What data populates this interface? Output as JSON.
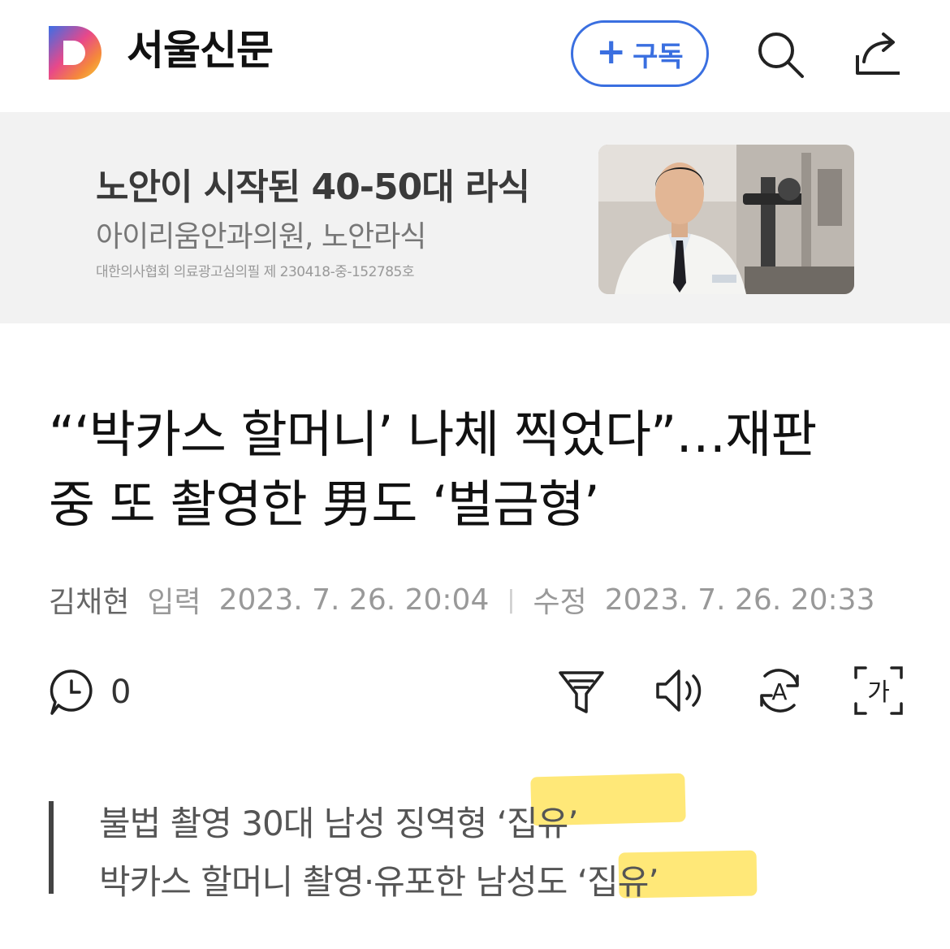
{
  "header": {
    "logo_letter": "D",
    "brand": "서울신문",
    "subscribe_label": "구독",
    "subscribe_plus": "+"
  },
  "ad": {
    "title": "노안이 시작된 40-50대 라식",
    "subtitle": "아이리움안과의원, 노안라식",
    "note": "대한의사협회 의료광고심의필 제 230418-중-152785호"
  },
  "article": {
    "headline_line1": "“‘박카스 할머니’ 나체 찍었다”…재판",
    "headline_line2": "중 또 촬영한 男도 ‘벌금형’",
    "author": "김채현",
    "input_label": "입력",
    "input_date": "2023. 7. 26. 20:04",
    "separator": "|",
    "edit_label": "수정",
    "edit_date": "2023. 7. 26. 20:33"
  },
  "toolbar": {
    "comment_count": "0",
    "font_size_glyph": "가",
    "translate_glyph": "A"
  },
  "summary": {
    "line1": "불법 촬영 30대 남성 징역형 ‘집유’",
    "line2": "박카스 할머니 촬영·유포한 남성도 ‘집유’"
  },
  "colors": {
    "accent": "#3a6fe0",
    "highlight": "#ffd60a",
    "ad_background": "#f2f2f2"
  },
  "icons": [
    "search-icon",
    "share-icon",
    "comment-icon",
    "filter-icon",
    "speaker-icon",
    "translate-icon",
    "font-size-icon"
  ]
}
